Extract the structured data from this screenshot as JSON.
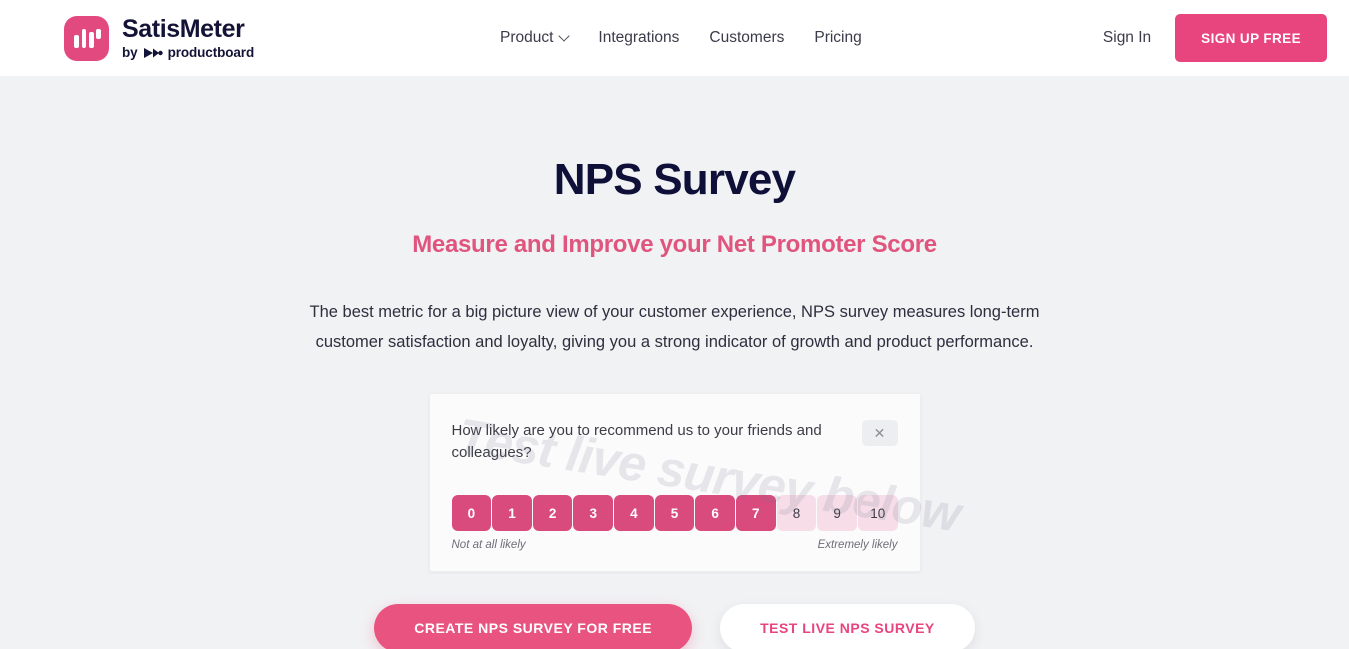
{
  "header": {
    "brand": {
      "name": "SatisMeter",
      "by_prefix": "by",
      "by_company": "productboard",
      "logo_icon": "satismeter-bars-icon",
      "logo_color": "#e24a7f"
    },
    "nav": [
      {
        "label": "Product",
        "has_dropdown": true,
        "icon": "chevron-down-icon"
      },
      {
        "label": "Integrations",
        "has_dropdown": false
      },
      {
        "label": "Customers",
        "has_dropdown": false
      },
      {
        "label": "Pricing",
        "has_dropdown": false
      }
    ],
    "signin_label": "Sign In",
    "signup_label": "SIGN UP FREE",
    "signup_color": "#e8447e"
  },
  "hero": {
    "title": "NPS Survey",
    "title_color": "#0e1038",
    "subtitle": "Measure and Improve your Net Promoter Score",
    "subtitle_color": "#e0557e",
    "description": "The best metric for a big picture view of your customer experience, NPS survey measures long-term customer satisfaction and loyalty, giving you a strong indicator of growth and product performance."
  },
  "survey": {
    "watermark": "Test live survey below",
    "question": "How likely are you to recommend us to your friends and colleagues?",
    "close_icon": "close-icon",
    "close_glyph": "✕",
    "scores": [
      {
        "value": "0",
        "state": "active"
      },
      {
        "value": "1",
        "state": "active"
      },
      {
        "value": "2",
        "state": "active"
      },
      {
        "value": "3",
        "state": "active"
      },
      {
        "value": "4",
        "state": "active"
      },
      {
        "value": "5",
        "state": "active"
      },
      {
        "value": "6",
        "state": "active"
      },
      {
        "value": "7",
        "state": "active"
      },
      {
        "value": "8",
        "state": "pale"
      },
      {
        "value": "9",
        "state": "pale"
      },
      {
        "value": "10",
        "state": "pale"
      }
    ],
    "active_color": "#d94a7d",
    "pale_color": "#f6dde7",
    "label_low": "Not at all likely",
    "label_high": "Extremely likely"
  },
  "cta": {
    "primary_label": "CREATE NPS SURVEY FOR FREE",
    "secondary_label": "TEST LIVE NPS SURVEY"
  }
}
